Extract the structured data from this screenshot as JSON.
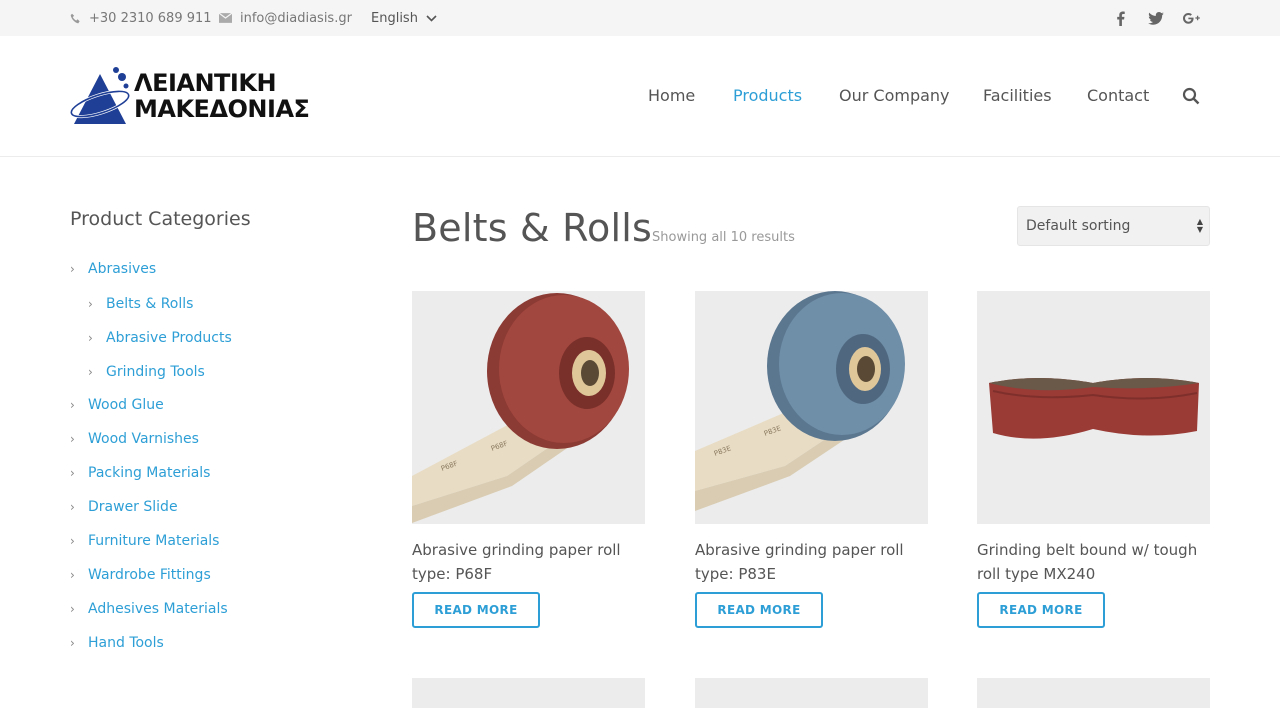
{
  "topbar": {
    "phone": "+30 2310 689 911",
    "email": "info@diadiasis.gr",
    "language": "English"
  },
  "brand": {
    "line1": "ΛΕΙΑΝΤΙΚΗ",
    "line2": "ΜΑΚΕΔΟΝΙΑΣ",
    "accent_color": "#1f3f96"
  },
  "nav": {
    "items": [
      {
        "label": "Home"
      },
      {
        "label": "Products"
      },
      {
        "label": "Our Company"
      },
      {
        "label": "Facilities"
      },
      {
        "label": "Contact"
      }
    ],
    "active": "Products",
    "active_color": "#2e9fd6"
  },
  "sidebar": {
    "title": "Product Categories",
    "categories": [
      {
        "label": "Abrasives"
      },
      {
        "label": "Belts & Rolls"
      },
      {
        "label": "Abrasive Products"
      },
      {
        "label": "Grinding Tools"
      },
      {
        "label": "Wood Glue"
      },
      {
        "label": "Wood Varnishes"
      },
      {
        "label": "Packing Materials"
      },
      {
        "label": "Drawer Slide"
      },
      {
        "label": "Furniture Materials"
      },
      {
        "label": "Wardrobe Fittings"
      },
      {
        "label": "Adhesives Materials"
      },
      {
        "label": "Hand Tools"
      }
    ]
  },
  "main": {
    "title": "Belts & Rolls",
    "result_count": "Showing all 10 results",
    "sort_selected": "Default sorting",
    "products": [
      {
        "name_line1": "Abrasive grinding paper roll",
        "name_line2": "type: P68F",
        "button": "READ MORE",
        "image": "red-abrasive-roll"
      },
      {
        "name_line1": "Abrasive grinding paper roll",
        "name_line2": "type: P83E",
        "button": "READ MORE",
        "image": "blue-abrasive-roll"
      },
      {
        "name_line1": "Grinding belt bound w/ tough",
        "name_line2": "roll type MX240",
        "button": "READ MORE",
        "image": "grinding-belt"
      }
    ]
  }
}
